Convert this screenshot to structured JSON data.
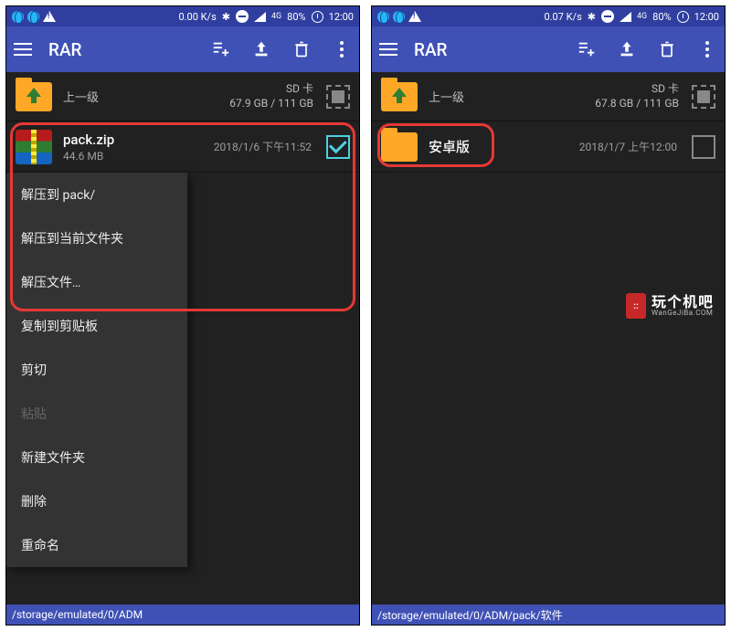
{
  "status": {
    "net_speed_left": "0.00 K/s",
    "net_speed_right": "0.07 K/s",
    "net_label": "4G",
    "battery": "80%",
    "time": "12:00"
  },
  "appbar": {
    "title": "RAR"
  },
  "nav": {
    "up_label": "上一级",
    "sd_label": "SD 卡",
    "stats_left": "67.9 GB / 111 GB",
    "stats_right": "67.8 GB / 111 GB"
  },
  "left_file": {
    "name": "pack.zip",
    "size": "44.6 MB",
    "date": "2018/1/6 下午11:52"
  },
  "right_file": {
    "name": "安卓版",
    "date": "2018/1/7 上午12:00"
  },
  "context_menu": {
    "items": [
      {
        "label": "解压到 pack/",
        "enabled": true
      },
      {
        "label": "解压到当前文件夹",
        "enabled": true
      },
      {
        "label": "解压文件…",
        "enabled": true
      },
      {
        "label": "复制到剪贴板",
        "enabled": true
      },
      {
        "label": "剪切",
        "enabled": true
      },
      {
        "label": "粘贴",
        "enabled": false
      },
      {
        "label": "新建文件夹",
        "enabled": true
      },
      {
        "label": "删除",
        "enabled": true
      },
      {
        "label": "重命名",
        "enabled": true
      }
    ]
  },
  "path": {
    "left": "/storage/emulated/0/ADM",
    "right": "/storage/emulated/0/ADM/pack/软件"
  },
  "watermark": {
    "big": "玩个机吧",
    "small": "WanGeJiBa.COM"
  }
}
